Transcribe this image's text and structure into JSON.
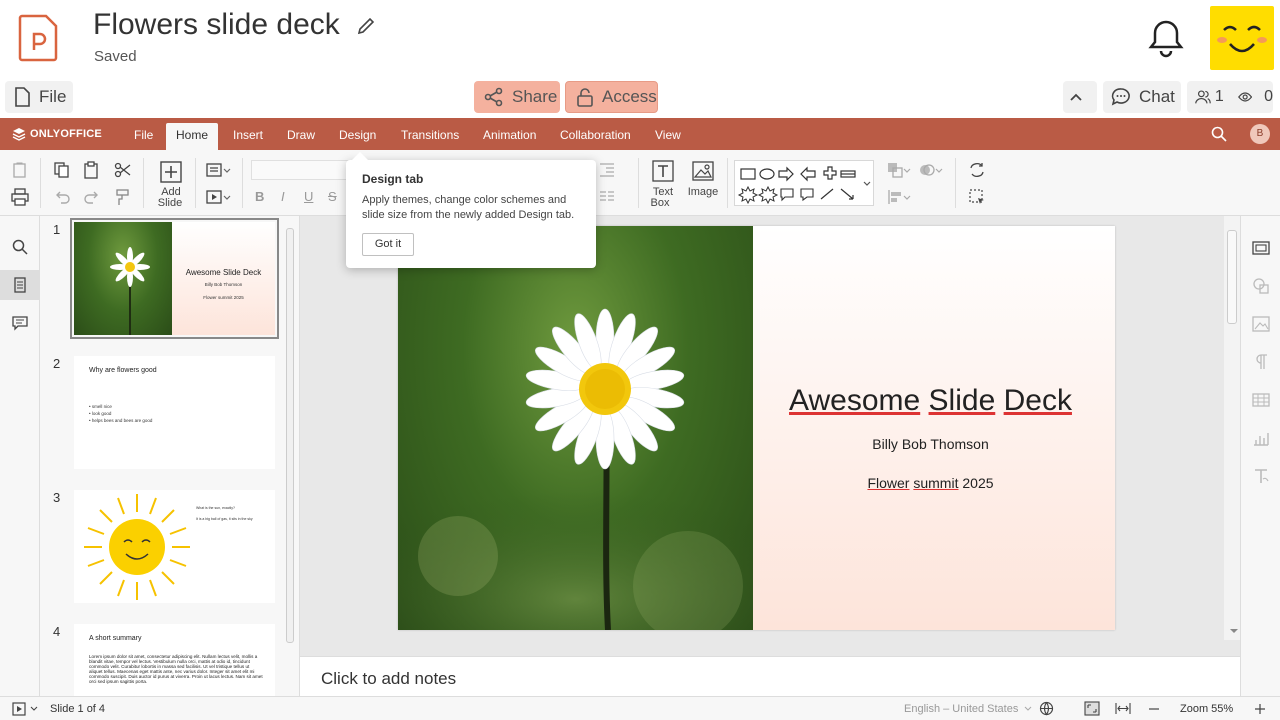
{
  "app": {
    "doc_title": "Flowers slide deck",
    "doc_status": "Saved"
  },
  "header": {
    "file_label": "File",
    "share_label": "Share",
    "access_label": "Access",
    "chat_label": "Chat",
    "users_count": "1",
    "viewers_count": "0"
  },
  "menubar": {
    "brand": "ONLYOFFICE",
    "user_initial": "B",
    "tabs": [
      {
        "label": "File"
      },
      {
        "label": "Home"
      },
      {
        "label": "Insert"
      },
      {
        "label": "Draw"
      },
      {
        "label": "Design"
      },
      {
        "label": "Transitions"
      },
      {
        "label": "Animation"
      },
      {
        "label": "Collaboration"
      },
      {
        "label": "View"
      }
    ]
  },
  "toolbar": {
    "add_slide_line1": "Add",
    "add_slide_line2": "Slide",
    "text_box_line1": "Text",
    "text_box_line2": "Box",
    "image_label": "Image",
    "bold": "B",
    "italic": "I",
    "underline": "U",
    "strike": "S"
  },
  "tooltip": {
    "title": "Design tab",
    "body": "Apply themes, change color schemes and slide size from the newly added Design tab.",
    "button": "Got it"
  },
  "thumbnails": [
    {
      "num": "1",
      "title": "Awesome Slide Deck",
      "author": "Billy Bob Thomson",
      "event": "Flower summit 2025"
    },
    {
      "num": "2",
      "title": "Why are flowers good",
      "bullets": [
        "• smell nice",
        "• look good",
        "• helps bees and bees are good"
      ]
    },
    {
      "num": "3",
      "title": "What is the sun, exactly?",
      "subtitle": "It is a big ball of gas, it sits in the sky"
    },
    {
      "num": "4",
      "title": "A short summary",
      "body": "Lorem ipsum dolor sit amet, consectetur adipiscing elit. Nullam lectus velit, mollis a blandit vitae, tempor vel lectus. Vestibulum nulla orci, mattis at odio id, tincidunt commodo velit. Curabitur lobortis in massa sed facilisis. Ut vel tristique tellus ut aliquet tellus. Maecenas eget mattis ante, nec varius dolor. Integer sit amet elit mi commodo suscipit. Duis auctor id purus at viverra. Proin ut lacus lectus. Nam sit amet orci sed ipsum sagittis porta."
    }
  ],
  "slide": {
    "title_word1": "Awesome",
    "title_word2": "Slide",
    "title_word3": "Deck",
    "author": "Billy Bob Thomson",
    "event_word1": "Flower",
    "event_word2": "summit",
    "event_year": "2025"
  },
  "notes": {
    "placeholder": "Click to add notes"
  },
  "statusbar": {
    "slide_counter": "Slide 1 of 4",
    "language": "English – United States",
    "zoom": "Zoom 55%"
  },
  "colors": {
    "accent": "#ba5b45",
    "share_bg": "#f4b19e"
  }
}
